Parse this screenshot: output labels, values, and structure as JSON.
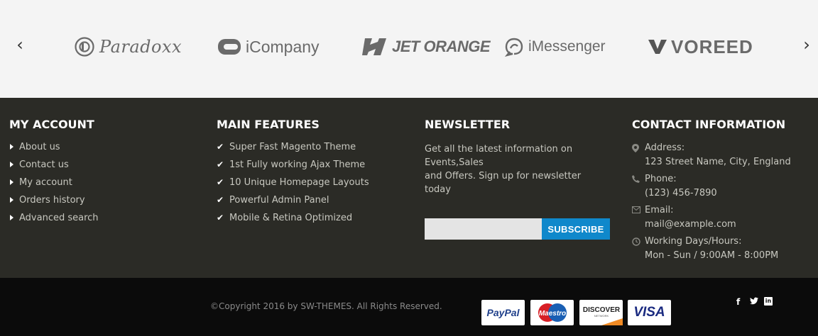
{
  "brands": {
    "items": [
      {
        "name": "Paradoxx"
      },
      {
        "name": "iCompany"
      },
      {
        "name": "JET ORANGE"
      },
      {
        "name": "iMessenger"
      },
      {
        "name": "VOREED"
      }
    ],
    "prev_icon": "‹",
    "next_icon": "›"
  },
  "footer": {
    "account": {
      "title": "MY ACCOUNT",
      "links": [
        "About us",
        "Contact us",
        "My account",
        "Orders history",
        "Advanced search"
      ]
    },
    "features": {
      "title": "MAIN FEATURES",
      "items": [
        "Super Fast Magento Theme",
        "1st Fully working Ajax Theme",
        "10 Unique Homepage Layouts",
        "Powerful Admin Panel",
        "Mobile & Retina Optimized"
      ]
    },
    "newsletter": {
      "title": "NEWSLETTER",
      "text_line1": "Get all the latest information on",
      "text_line2": "Events,Sales",
      "text_line3": "and Offers. Sign up for newsletter today",
      "input_value": "",
      "button_label": "SUBSCRIBE"
    },
    "contact": {
      "title": "CONTACT INFORMATION",
      "address_label": "Address:",
      "address_value": "123 Street Name, City, England",
      "phone_label": "Phone:",
      "phone_value": "(123) 456-7890",
      "email_label": "Email:",
      "email_value": "mail@example.com",
      "hours_label": "Working Days/Hours:",
      "hours_value": "Mon - Sun / 9:00AM - 8:00PM"
    }
  },
  "bottom": {
    "copyright": "©Copyright 2016 by SW-THEMES. All Rights Reserved.",
    "payments": [
      "PayPal",
      "Maestro",
      "DISCOVER",
      "VISA"
    ],
    "discover_sub": "NETWORK",
    "social": {
      "facebook": "f",
      "twitter": "t",
      "linkedin": "in"
    }
  },
  "colors": {
    "footer_bg": "#2b2b26",
    "bottom_bg": "#0b0b0b",
    "accent": "#0f88cb",
    "brands_bg": "#f4f4f4"
  }
}
